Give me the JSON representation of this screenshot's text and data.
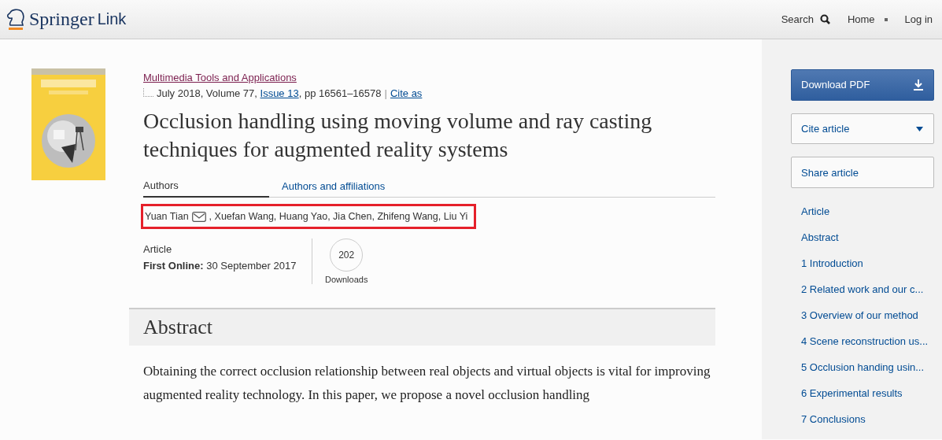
{
  "header": {
    "logo_word_1": "Springer",
    "logo_word_2": "Link",
    "nav": [
      {
        "label": "Search",
        "kind": "search"
      },
      {
        "label": "Home",
        "kind": "link"
      },
      {
        "label": "Log in",
        "kind": "link"
      }
    ]
  },
  "journal": {
    "name": "Multimedia Tools and Applications",
    "date_volume": "July 2018, Volume 77, ",
    "issue": "Issue 13",
    "pages": ", pp 16561–16578",
    "separator": "|",
    "cite_as": "Cite as"
  },
  "title": "Occlusion handling using moving volume and ray casting techniques for augmented reality systems",
  "tabs": [
    {
      "label": "Authors",
      "selected": true
    },
    {
      "label": "Authors and affiliations",
      "selected": false
    }
  ],
  "authors": {
    "highlighted": true,
    "first": "Yuan Tian",
    "rest": ", Xuefan Wang, Huang Yao, Jia Chen, Zhifeng Wang, Liu Yi"
  },
  "meta": {
    "type": "Article",
    "first_online_label": "First Online:",
    "first_online": "30 September 2017",
    "downloads": "202",
    "downloads_label": "Downloads"
  },
  "abstract": {
    "heading": "Abstract",
    "text": "Obtaining the correct occlusion relationship between real objects and virtual objects is vital for improving augmented reality technology. In this paper, we propose a novel occlusion handling"
  },
  "sidebar": {
    "buttons": [
      {
        "label": "Download PDF",
        "kind": "primary"
      },
      {
        "label": "Cite article",
        "kind": "dropdown"
      },
      {
        "label": "Share article",
        "kind": "plain"
      }
    ],
    "toc": [
      "Article",
      "Abstract",
      "1 Introduction",
      "2 Related work and our c...",
      "3 Overview of our method",
      "4 Scene reconstruction us...",
      "5 Occlusion handing usin...",
      "6 Experimental results",
      "7 Conclusions"
    ]
  }
}
